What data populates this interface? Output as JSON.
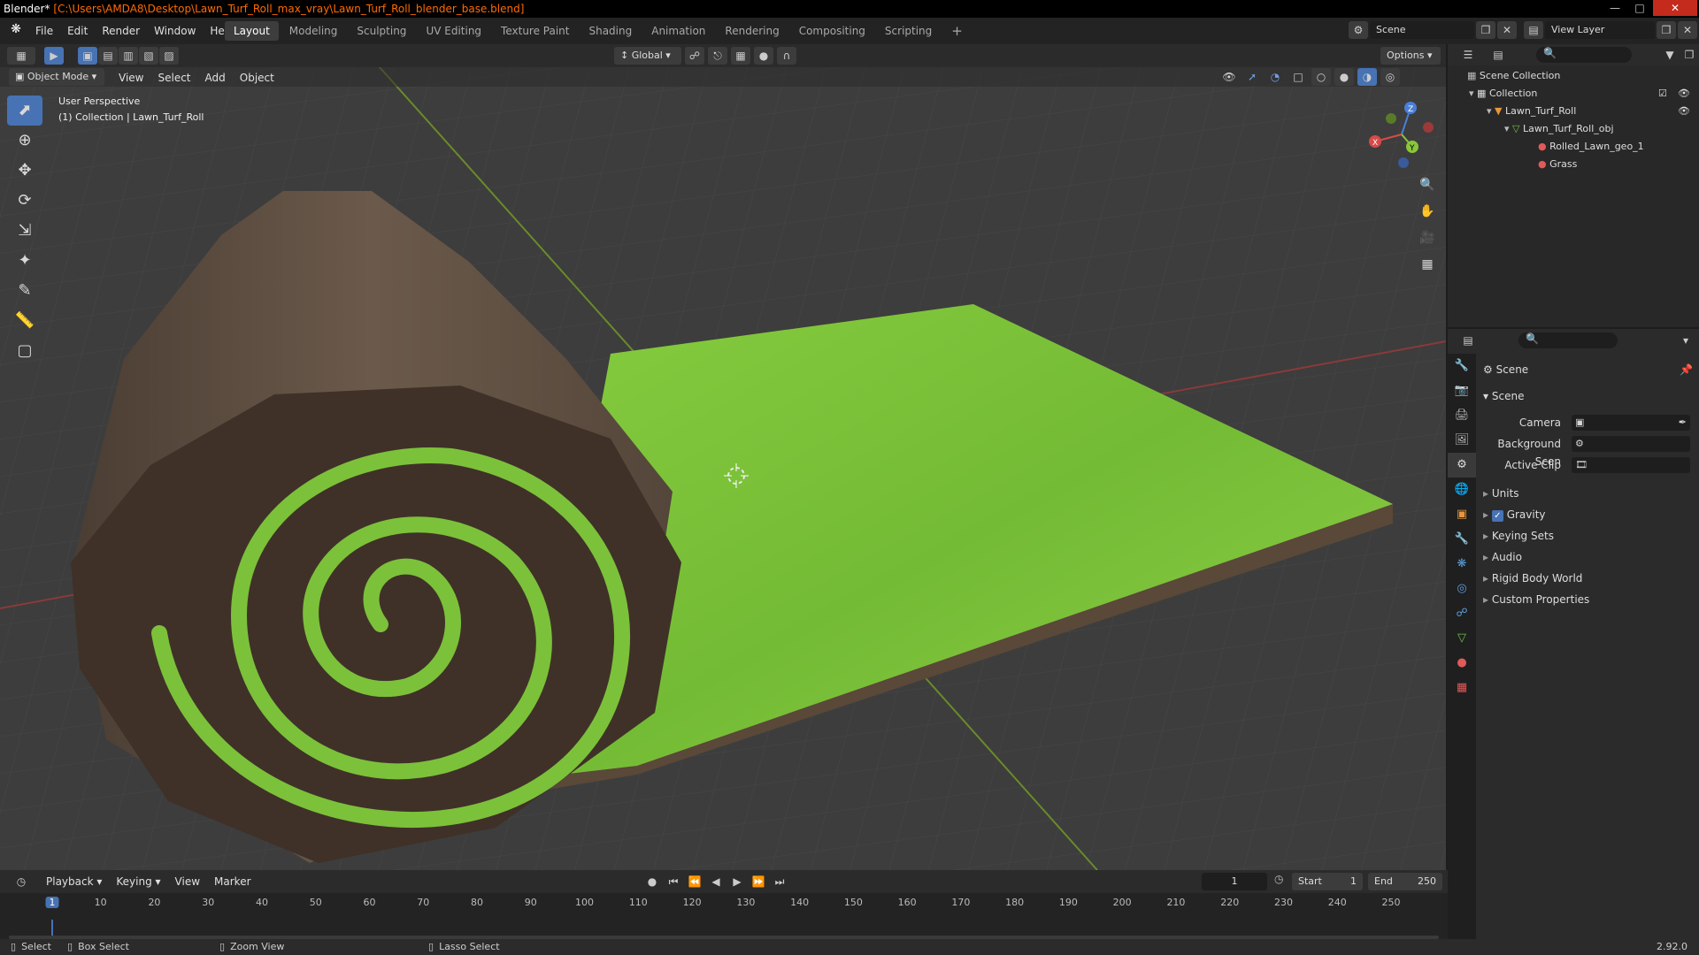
{
  "window": {
    "app": "Blender*",
    "path": "[C:\\Users\\AMDA8\\Desktop\\Lawn_Turf_Roll_max_vray\\Lawn_Turf_Roll_blender_base.blend]"
  },
  "menu": [
    "File",
    "Edit",
    "Render",
    "Window",
    "Help"
  ],
  "workspaces": [
    "Layout",
    "Modeling",
    "Sculpting",
    "UV Editing",
    "Texture Paint",
    "Shading",
    "Animation",
    "Rendering",
    "Compositing",
    "Scripting"
  ],
  "active_workspace": "Layout",
  "scene_selector": {
    "label": "Scene"
  },
  "view_layer_selector": {
    "label": "View Layer"
  },
  "viewport_header": {
    "mode": "Object Mode",
    "menus": [
      "View",
      "Select",
      "Add",
      "Object"
    ],
    "transform_orientation": "Global",
    "options": "Options"
  },
  "viewport": {
    "perspective": "User Perspective",
    "collection_info": "(1) Collection | Lawn_Turf_Roll"
  },
  "gizmo": {
    "x": "X",
    "y": "Y",
    "z": "Z"
  },
  "outliner": {
    "rows": [
      {
        "label": "Scene Collection",
        "icon": "scene-collection-icon"
      },
      {
        "label": "Collection",
        "icon": "collection-icon"
      },
      {
        "label": "Lawn_Turf_Roll",
        "icon": "object-icon"
      },
      {
        "label": "Lawn_Turf_Roll_obj",
        "icon": "mesh-icon"
      },
      {
        "label": "Rolled_Lawn_geo_1",
        "icon": "material-icon"
      },
      {
        "label": "Grass",
        "icon": "material-icon"
      }
    ]
  },
  "properties": {
    "context": "Scene",
    "panel_title": "Scene",
    "camera_label": "Camera",
    "background_label": "Background Scen",
    "active_clip_label": "Active Clip",
    "subpanels": [
      "Units",
      "Gravity",
      "Keying Sets",
      "Audio",
      "Rigid Body World",
      "Custom Properties"
    ],
    "gravity_checked": true
  },
  "timeline": {
    "menus": [
      "Playback",
      "Keying",
      "View",
      "Marker"
    ],
    "current_frame": "1",
    "start_label": "Start",
    "start": "1",
    "end_label": "End",
    "end": "250",
    "ticks": [
      "1",
      "10",
      "20",
      "30",
      "40",
      "50",
      "60",
      "70",
      "80",
      "90",
      "100",
      "110",
      "120",
      "130",
      "140",
      "150",
      "160",
      "170",
      "180",
      "190",
      "200",
      "210",
      "220",
      "230",
      "240",
      "250"
    ]
  },
  "statusbar": {
    "select": "Select",
    "box_select": "Box Select",
    "zoom_view": "Zoom View",
    "lasso_select": "Lasso Select",
    "version": "2.92.0"
  },
  "colors": {
    "accent": "#4772b3",
    "title_path": "#ff6a00",
    "grass": "#7cc13a",
    "soil": "#5a4a3e"
  }
}
